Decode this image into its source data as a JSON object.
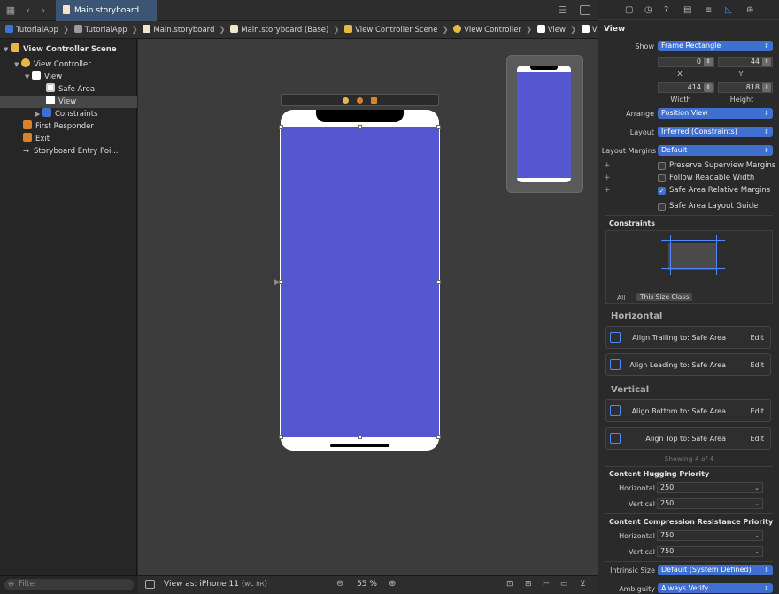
{
  "toolbar": {
    "tab_label": "Main.storyboard"
  },
  "breadcrumbs": [
    "TutorialApp",
    "TutorialApp",
    "Main.storyboard",
    "Main.storyboard (Base)",
    "View Controller Scene",
    "View Controller",
    "View",
    "View"
  ],
  "navigator": {
    "scene_label": "View Controller Scene",
    "items": [
      {
        "label": "View Controller"
      },
      {
        "label": "View"
      },
      {
        "label": "Safe Area"
      },
      {
        "label": "View"
      },
      {
        "label": "Constraints"
      },
      {
        "label": "First Responder"
      },
      {
        "label": "Exit"
      },
      {
        "label": "Storyboard Entry Poi..."
      }
    ],
    "filter_placeholder": "Filter"
  },
  "bottom": {
    "view_as": "View as: iPhone 11 (",
    "view_as_traits": "wC hR",
    "view_as_end": ")",
    "zoom": "55 %"
  },
  "canvas": {
    "view_color": "#5557d0"
  },
  "inspector": {
    "title": "View",
    "show_label": "Show",
    "show_value": "Frame Rectangle",
    "x_value": "0",
    "y_value": "44",
    "x_label": "X",
    "y_label": "Y",
    "width_value": "414",
    "height_value": "818",
    "width_label": "Width",
    "height_label": "Height",
    "arrange_label": "Arrange",
    "arrange_value": "Position View",
    "layout_label": "Layout",
    "layout_value": "Inferred (Constraints)",
    "margins_label": "Layout Margins",
    "margins_value": "Default",
    "checks": [
      {
        "label": "Preserve Superview Margins",
        "checked": false
      },
      {
        "label": "Follow Readable Width",
        "checked": false
      },
      {
        "label": "Safe Area Relative Margins",
        "checked": true
      },
      {
        "label": "Safe Area Layout Guide",
        "checked": false
      }
    ],
    "constraints_header": "Constraints",
    "filter_all": "All",
    "filter_size_class": "This Size Class",
    "horizontal_header": "Horizontal",
    "horizontal": [
      {
        "text": "Align Trailing to:  Safe Area",
        "edit": "Edit"
      },
      {
        "text": "Align Leading to:  Safe Area",
        "edit": "Edit"
      }
    ],
    "vertical_header": "Vertical",
    "vertical": [
      {
        "text": "Align Bottom to:  Safe Area",
        "edit": "Edit"
      },
      {
        "text": "Align Top to:  Safe Area",
        "edit": "Edit"
      }
    ],
    "showing": "Showing 4 of 4",
    "hugging_header": "Content Hugging Priority",
    "hug_h_label": "Horizontal",
    "hug_h_value": "250",
    "hug_v_label": "Vertical",
    "hug_v_value": "250",
    "compression_header": "Content Compression Resistance Priority",
    "comp_h_label": "Horizontal",
    "comp_h_value": "750",
    "comp_v_label": "Vertical",
    "comp_v_value": "750",
    "intrinsic_label": "Intrinsic Size",
    "intrinsic_value": "Default (System Defined)",
    "ambiguity_label": "Ambiguity",
    "ambiguity_value": "Always Verify"
  }
}
